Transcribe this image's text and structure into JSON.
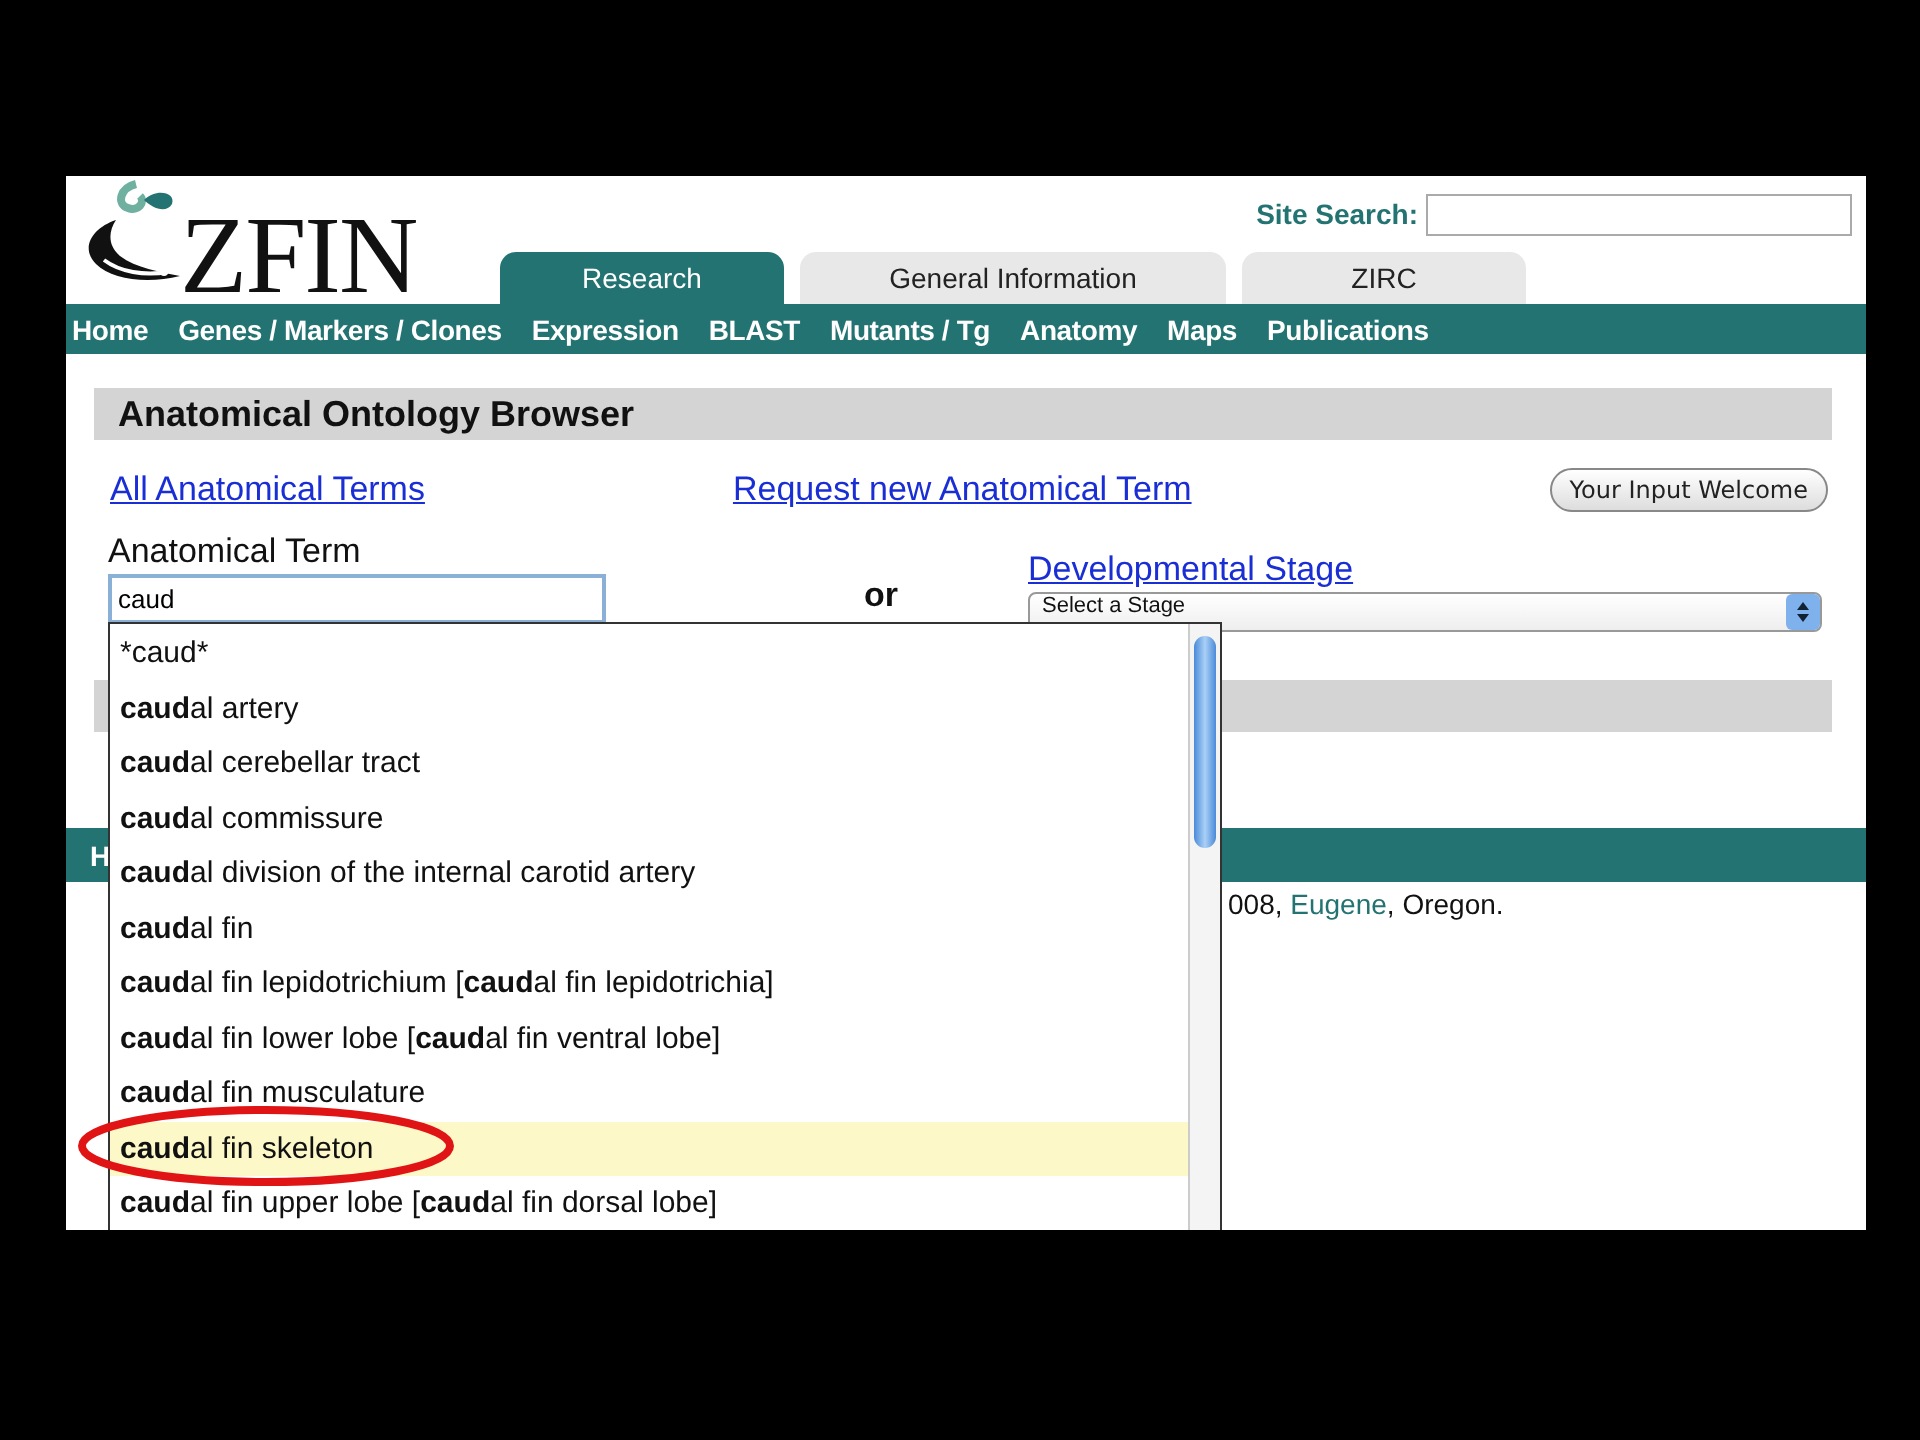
{
  "logo": {
    "text": "ZFIN"
  },
  "site_search": {
    "label": "Site Search:"
  },
  "tabs": [
    {
      "label": "Research",
      "selected": true
    },
    {
      "label": "General Information",
      "selected": false
    },
    {
      "label": "ZIRC",
      "selected": false
    }
  ],
  "nav": [
    "Home",
    "Genes / Markers / Clones",
    "Expression",
    "BLAST",
    "Mutants / Tg",
    "Anatomy",
    "Maps",
    "Publications"
  ],
  "page_title": "Anatomical Ontology Browser",
  "links": {
    "all_terms": "All Anatomical Terms",
    "request": "Request new Anatomical Term"
  },
  "feedback_button": "Your Input Welcome",
  "term_field": {
    "label": "Anatomical Term",
    "value": "caud"
  },
  "or_label": "or",
  "stage": {
    "label": "Developmental Stage",
    "value": "Select a Stage"
  },
  "footer": {
    "bar_text": "H",
    "text_before": "008, ",
    "link": "Eugene",
    "text_after": ", Oregon."
  },
  "suggestions": [
    {
      "kind": "query",
      "text": "*caud*",
      "selected": false
    },
    {
      "kind": "term",
      "text": "**caud**al artery",
      "selected": false
    },
    {
      "kind": "term",
      "text": "**caud**al cerebellar tract",
      "selected": false
    },
    {
      "kind": "term",
      "text": "**caud**al commissure",
      "selected": false
    },
    {
      "kind": "term",
      "text": "**caud**al division of the internal carotid artery",
      "selected": false
    },
    {
      "kind": "term",
      "text": "**caud**al fin",
      "selected": false
    },
    {
      "kind": "term",
      "text": "**caud**al fin lepidotrichium [**caud**al fin lepidotrichia]",
      "selected": false
    },
    {
      "kind": "term",
      "text": "**caud**al fin lower lobe [**caud**al fin ventral lobe]",
      "selected": false
    },
    {
      "kind": "term",
      "text": "**caud**al fin musculature",
      "selected": false
    },
    {
      "kind": "term",
      "text": "**caud**al fin skeleton",
      "selected": true
    },
    {
      "kind": "term",
      "text": "**caud**al fin upper lobe [**caud**al fin dorsal lobe]",
      "selected": false
    }
  ],
  "annotations": [
    {
      "kind": "ellipse"
    }
  ]
}
